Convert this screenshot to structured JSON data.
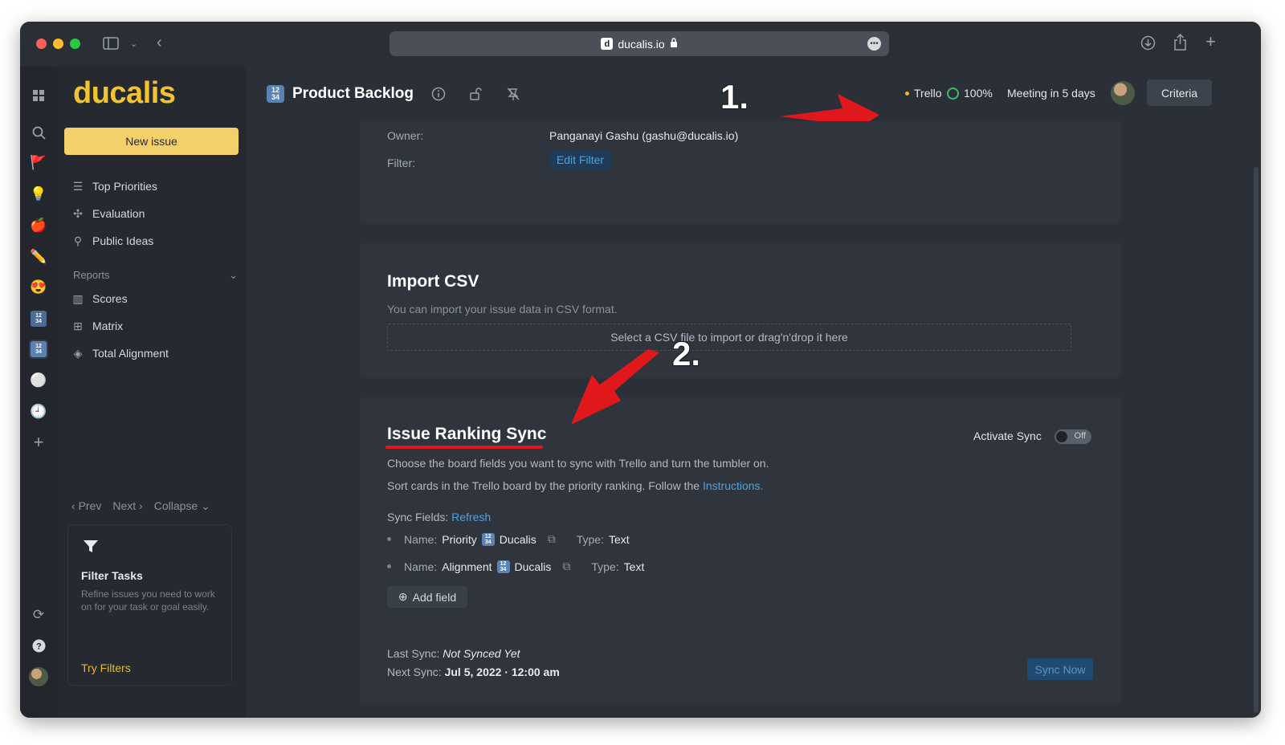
{
  "browser": {
    "url": "ducalis.io",
    "favicon_letter": "d"
  },
  "sidebar": {
    "logo": "ducalis",
    "new_issue_label": "New issue",
    "items": [
      {
        "label": "Top Priorities",
        "icon": "list-icon"
      },
      {
        "label": "Evaluation",
        "icon": "evaluation-icon"
      },
      {
        "label": "Public Ideas",
        "icon": "public-ideas-icon"
      }
    ],
    "reports_label": "Reports",
    "report_items": [
      {
        "label": "Scores",
        "icon": "columns-icon"
      },
      {
        "label": "Matrix",
        "icon": "grid-icon"
      },
      {
        "label": "Total Alignment",
        "icon": "layers-icon"
      }
    ],
    "pager": {
      "prev": "Prev",
      "next": "Next",
      "collapse": "Collapse"
    },
    "filter_card": {
      "title": "Filter Tasks",
      "description": "Refine issues you need to work on for your task or goal easily.",
      "link": "Try Filters"
    }
  },
  "header": {
    "badge": "12 34",
    "title": "Product Backlog",
    "integration": "Trello",
    "progress": "100%",
    "meeting": "Meeting in 5 days",
    "criteria_label": "Criteria"
  },
  "owner_section": {
    "owner_label": "Owner:",
    "owner_value": "Panganayi Gashu (gashu@ducalis.io)",
    "filter_label": "Filter:",
    "edit_filter_label": "Edit Filter"
  },
  "import_csv": {
    "title": "Import CSV",
    "description": "You can import your issue data in CSV format.",
    "dropzone": "Select a CSV file to import or drag'n'drop it here"
  },
  "sync": {
    "title": "Issue Ranking Sync",
    "activate_label": "Activate Sync",
    "toggle_state": "Off",
    "line1": "Choose the board fields you want to sync with Trello and turn the tumbler on.",
    "line2_prefix": "Sort cards in the Trello board by the priority ranking. Follow the",
    "instructions_link": "Instructions.",
    "sync_fields_label": "Sync Fields:",
    "refresh_label": "Refresh",
    "fields": [
      {
        "name_label": "Name:",
        "name": "Priority",
        "app": "Ducalis",
        "type_label": "Type:",
        "type": "Text"
      },
      {
        "name_label": "Name:",
        "name": "Alignment",
        "app": "Ducalis",
        "type_label": "Type:",
        "type": "Text"
      }
    ],
    "add_field_label": "Add field",
    "last_sync_label": "Last Sync:",
    "last_sync_value": "Not Synced Yet",
    "next_sync_label": "Next Sync:",
    "next_sync_value": "Jul 5, 2022 · 12:00 am",
    "sync_now_label": "Sync Now"
  },
  "annotations": {
    "step1": "1.",
    "step2": "2.",
    "color": "#e0181c"
  }
}
